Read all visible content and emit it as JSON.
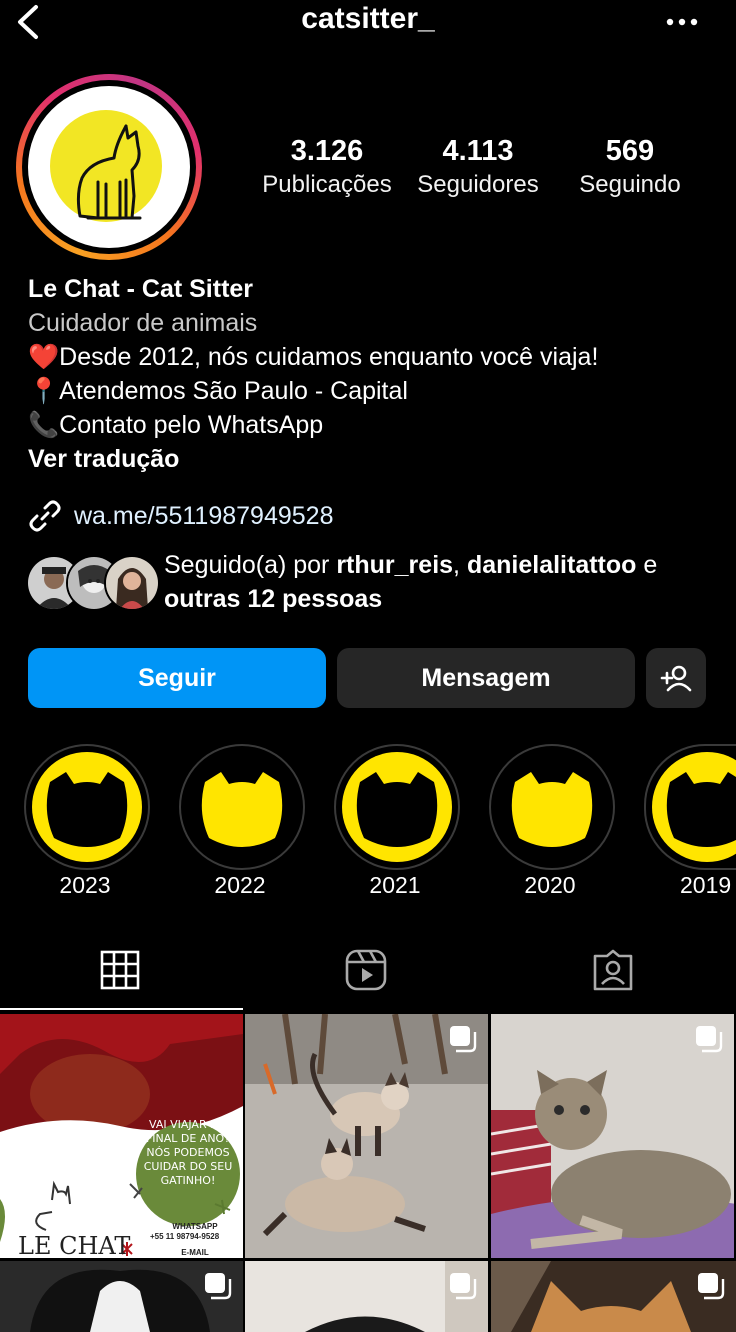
{
  "header": {
    "username": "catsitter_"
  },
  "stats": [
    {
      "value": "3.126",
      "label": "Publicações"
    },
    {
      "value": "4.113",
      "label": "Seguidores"
    },
    {
      "value": "569",
      "label": "Seguindo"
    }
  ],
  "bio": {
    "name": "Le Chat - Cat Sitter",
    "category": "Cuidador de animais",
    "line1_emoji": "❤️",
    "line1": "Desde 2012, nós cuidamos enquanto você viaja!",
    "line2_emoji": "📍",
    "line2": "Atendemos São Paulo - Capital",
    "line3_emoji": "📞",
    "line3": "Contato pelo WhatsApp",
    "translate": "Ver tradução"
  },
  "link": {
    "text": "wa.me/5511987949528"
  },
  "followed_by": {
    "prefix": "Seguido(a) por ",
    "user1": "rthur_reis",
    "sep": ", ",
    "user2": "danielalitattoo",
    "suffix": " e",
    "others": "outras 12 pessoas"
  },
  "actions": {
    "follow": "Seguir",
    "message": "Mensagem"
  },
  "highlights": [
    "2023",
    "2022",
    "2021",
    "2020",
    "2019"
  ],
  "tabs": [
    "grid-icon",
    "reels-icon",
    "tagged-icon"
  ],
  "posts": {
    "post1": {
      "bubble_line1": "VAI VIAJAR NO",
      "bubble_line2": "FINAL DE ANO?",
      "bubble_line3": "NÓS PODEMOS",
      "bubble_line4": "CUIDAR DO SEU",
      "bubble_line5": "GATINHO!",
      "logo": "LE CHAT",
      "whatsapp_label": "WHATSAPP",
      "whatsapp_number": "+55 11 98794-9528",
      "email_label": "E-MAIL"
    }
  },
  "colors": {
    "accent": "#0095f6",
    "button_dark": "#262626",
    "highlight_yellow": "#ffe500"
  }
}
